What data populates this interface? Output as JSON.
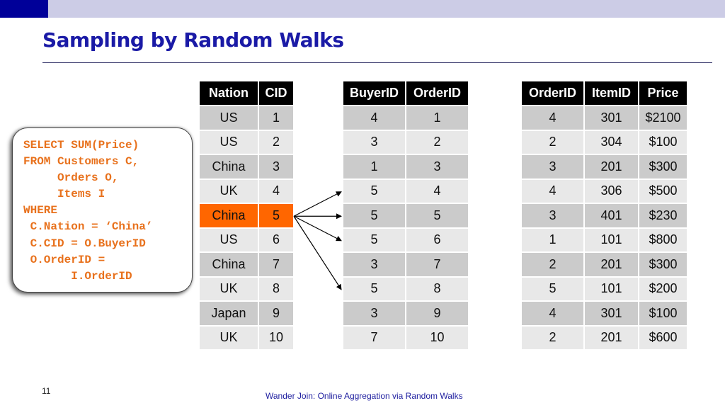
{
  "slide": {
    "title": "Sampling by Random Walks",
    "page_number": "11",
    "footer": "Wander Join: Online Aggregation via Random Walks",
    "colors": {
      "accent_dark": "#000099",
      "accent_light": "#CCCCE6",
      "highlight": "#FF6600",
      "sql_text": "#E8711C"
    }
  },
  "sql_query": {
    "lines": [
      "SELECT SUM(Price)",
      "FROM Customers C,",
      "     Orders O,",
      "     Items I",
      "WHERE",
      " C.Nation = ‘China’",
      " C.CID = O.BuyerID",
      " O.OrderID =",
      "       I.OrderID"
    ]
  },
  "customers": {
    "headers": [
      "Nation",
      "CID"
    ],
    "rows": [
      [
        "US",
        "1"
      ],
      [
        "US",
        "2"
      ],
      [
        "China",
        "3"
      ],
      [
        "UK",
        "4"
      ],
      [
        "China",
        "5"
      ],
      [
        "US",
        "6"
      ],
      [
        "China",
        "7"
      ],
      [
        "UK",
        "8"
      ],
      [
        "Japan",
        "9"
      ],
      [
        "UK",
        "10"
      ]
    ],
    "highlighted_row": 4
  },
  "orders": {
    "headers": [
      "BuyerID",
      "OrderID"
    ],
    "rows": [
      [
        "4",
        "1"
      ],
      [
        "3",
        "2"
      ],
      [
        "1",
        "3"
      ],
      [
        "5",
        "4"
      ],
      [
        "5",
        "5"
      ],
      [
        "5",
        "6"
      ],
      [
        "3",
        "7"
      ],
      [
        "5",
        "8"
      ],
      [
        "3",
        "9"
      ],
      [
        "7",
        "10"
      ]
    ]
  },
  "items": {
    "headers": [
      "OrderID",
      "ItemID",
      "Price"
    ],
    "rows": [
      [
        "4",
        "301",
        "$2100"
      ],
      [
        "2",
        "304",
        "$100"
      ],
      [
        "3",
        "201",
        "$300"
      ],
      [
        "4",
        "306",
        "$500"
      ],
      [
        "3",
        "401",
        "$230"
      ],
      [
        "1",
        "101",
        "$800"
      ],
      [
        "2",
        "201",
        "$300"
      ],
      [
        "5",
        "101",
        "$200"
      ],
      [
        "4",
        "301",
        "$100"
      ],
      [
        "2",
        "201",
        "$600"
      ]
    ]
  },
  "walk_arrows": {
    "from_customer_row": 4,
    "to_order_rows": [
      3,
      4,
      5,
      7
    ]
  }
}
